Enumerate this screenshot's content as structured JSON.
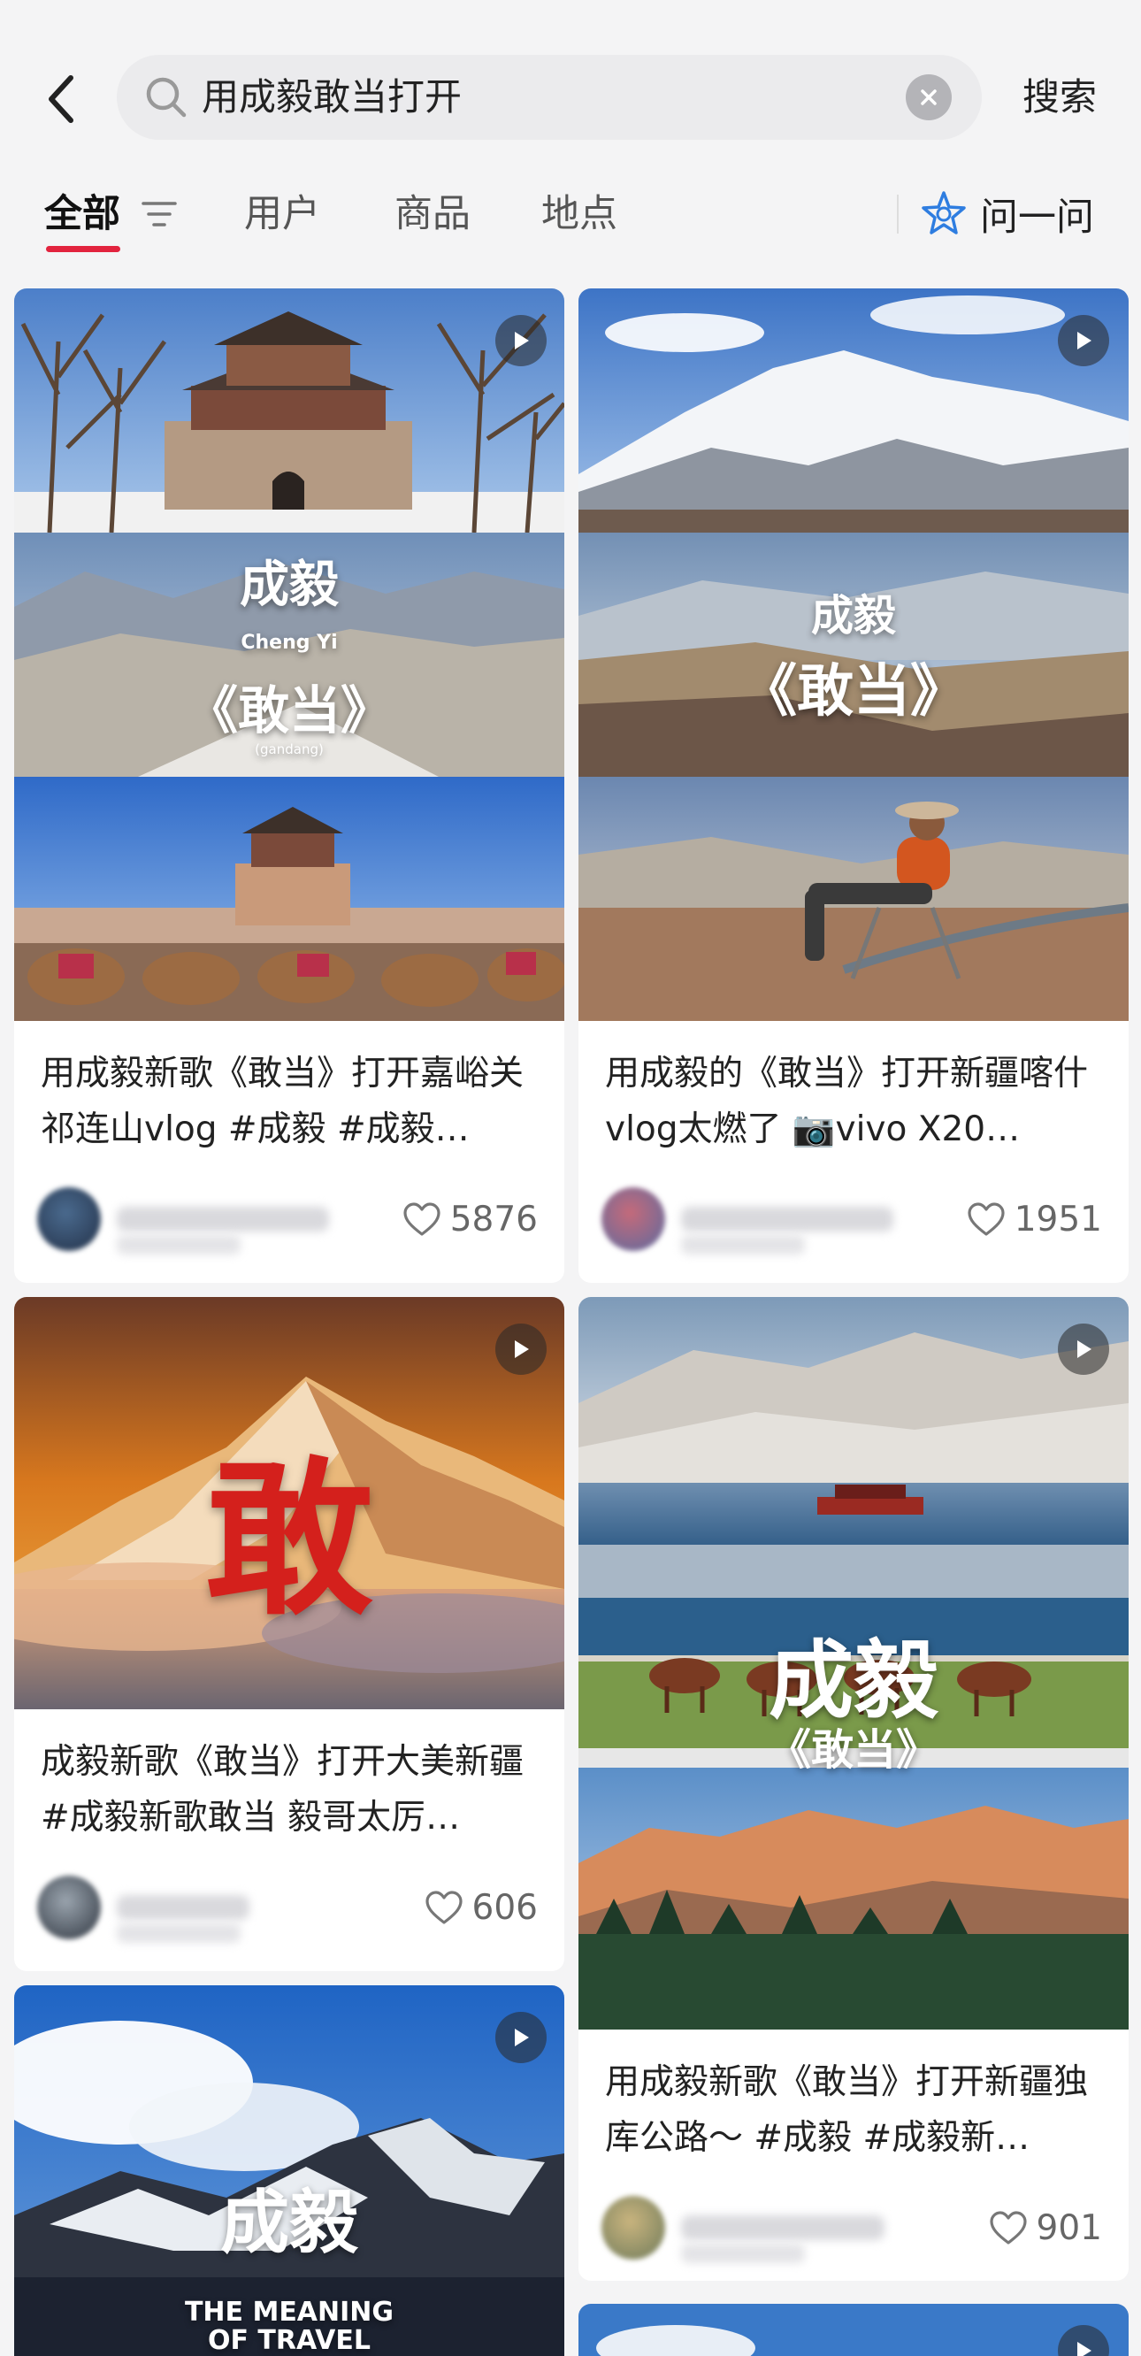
{
  "header": {
    "back_icon": "chevron-left-icon",
    "search_query": "用成毅敢当打开",
    "search_button": "搜索"
  },
  "tabs": [
    {
      "label": "全部",
      "active": true
    },
    {
      "label": "用户",
      "active": false
    },
    {
      "label": "商品",
      "active": false
    },
    {
      "label": "地点",
      "active": false
    }
  ],
  "ask": {
    "label": "问一问"
  },
  "colors": {
    "accent": "#e2233e",
    "background": "#f4f4f5"
  },
  "cards": [
    {
      "title": "用成毅新歌《敢当》打开嘉峪关祁连山vlog #成毅  #成毅…",
      "likes": "5876",
      "overlay": {
        "big": "成毅",
        "small": "Cheng Yi",
        "song": "《敢当》",
        "pinyin": "(gandang)"
      }
    },
    {
      "title": "用成毅的《敢当》打开新疆喀什vlog太燃了 📷vivo X20…",
      "likes": "1951",
      "overlay": {
        "big": "成毅",
        "song": "《敢当》"
      }
    },
    {
      "title": "成毅新歌《敢当》打开大美新疆 #成毅新歌敢当  毅哥太厉…",
      "likes": "606",
      "overlay": {
        "big": "敢"
      }
    },
    {
      "title": "用成毅新歌《敢当》打开新疆独库公路～ #成毅  #成毅新…",
      "likes": "901",
      "overlay": {
        "big": "成毅",
        "song": "《敢当》"
      }
    },
    {
      "overlay": {
        "big": "成毅",
        "sub1": "THE MEANING",
        "sub2": "OF TRAVEL"
      }
    }
  ]
}
